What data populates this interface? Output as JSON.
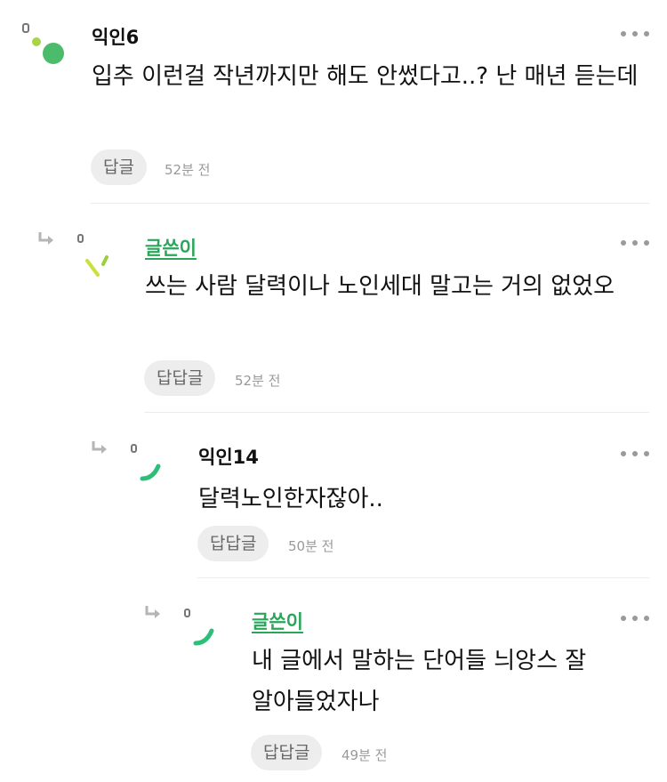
{
  "comments": [
    {
      "author": "익인6",
      "is_writer": false,
      "text": "입추 이런걸 작년까지만 해도 안썼다고..? 난 매년 듣는데",
      "reply_label": "답글",
      "time": "52분 전",
      "avatar_icon": "dots-avatar-icon",
      "colors": {
        "main": "#4cbb6c",
        "small": "#a8d44a"
      }
    },
    {
      "author": "글쓴이",
      "is_writer": true,
      "text": "쓰는 사람 달력이나 노인세대 말고는 거의 없었오",
      "reply_label": "답답글",
      "time": "52분 전",
      "avatar_icon": "slashes-avatar-icon",
      "colors": {
        "main": "#cbe03a",
        "small": "#9bcf3c"
      }
    },
    {
      "author": "익인14",
      "is_writer": false,
      "text": "달력노인한자잖아..",
      "reply_label": "답답글",
      "time": "50분 전",
      "avatar_icon": "arc-avatar-icon",
      "colors": {
        "main": "#2dbf7a"
      }
    },
    {
      "author": "글쓴이",
      "is_writer": true,
      "text": "내 글에서 말하는 단어들 늬앙스 잘 알아들었자나",
      "reply_label": "답답글",
      "time": "49분 전",
      "avatar_icon": "arc-avatar-icon",
      "colors": {
        "main": "#2dbf7a"
      }
    }
  ],
  "icons": {
    "reply_arrow": "reply-arrow-icon",
    "more": "more-options-icon"
  },
  "accent_color": "#2aa65a"
}
